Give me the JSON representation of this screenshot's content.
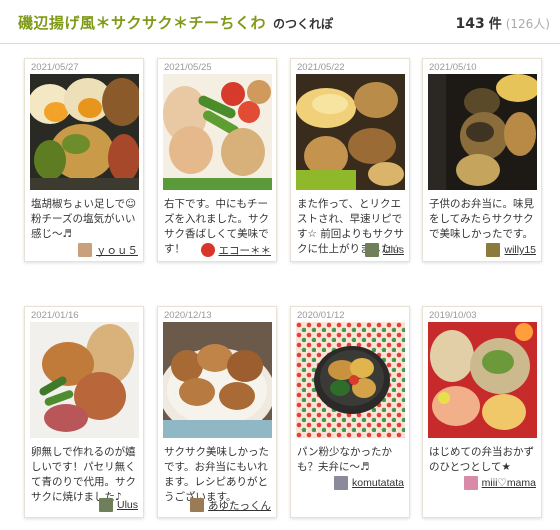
{
  "header": {
    "title": "磯辺揚げ風＊サクサク＊チーちくわ",
    "title_suffix": "のつくれぽ",
    "count": "143",
    "count_unit": "件",
    "count_sub": "(126人)"
  },
  "colors": {
    "accent": "#7e9a17",
    "border": "#e4dcc4"
  },
  "reports": [
    {
      "date": "2021/05/27",
      "comment": "塩胡椒ちょい足しで☺粉チーズの塩気がいい感じ〜♬",
      "author": "ｙｏｕ５",
      "avatar_color": "#c9a07a",
      "photo": "photo-bento-egg"
    },
    {
      "date": "2021/05/25",
      "comment": "右下です。中にもチーズを入れました。サクサク香ばしくて美味です！",
      "author": "エコー＊＊",
      "avatar_color": "#d9362b",
      "photo": "photo-bento-peas"
    },
    {
      "date": "2021/05/22",
      "comment": "また作って、とリクエストされ、早速リピです☆ 前回よりもサクサクに仕上がりました☆",
      "author": "Ulus",
      "avatar_color": "#6f7f5a",
      "photo": "photo-bento-yellow"
    },
    {
      "date": "2021/05/10",
      "comment": "子供のお弁当に。味見をしてみたらサクサクで美味しかったです。",
      "author": "willy15",
      "avatar_color": "#8c7a3c",
      "photo": "photo-bento-dark"
    },
    {
      "date": "2021/01/16",
      "comment": "卵無しで作れるのが嬉しいです！パセリ無くて青のりで代用。サクサクに焼けました♪",
      "author": "Ulus",
      "avatar_color": "#6f7f5a",
      "photo": "photo-bento-fried"
    },
    {
      "date": "2020/12/13",
      "comment": "サクサク美味しかったです。お弁当にもいれます。レシピありがとうございます。",
      "author": "あゆたっくん",
      "avatar_color": "#9a7b55",
      "photo": "photo-plate-chikuwa"
    },
    {
      "date": "2020/01/12",
      "comment": "パン粉少なかったかも？夫弁に〜♬",
      "author": "komutatata",
      "avatar_color": "#8a8a9a",
      "photo": "photo-bento-dots"
    },
    {
      "date": "2019/10/03",
      "comment": "はじめての弁当おかずのひとつとして★",
      "author": "miii♡mama",
      "avatar_color": "#d98aa8",
      "photo": "photo-bento-red"
    }
  ]
}
